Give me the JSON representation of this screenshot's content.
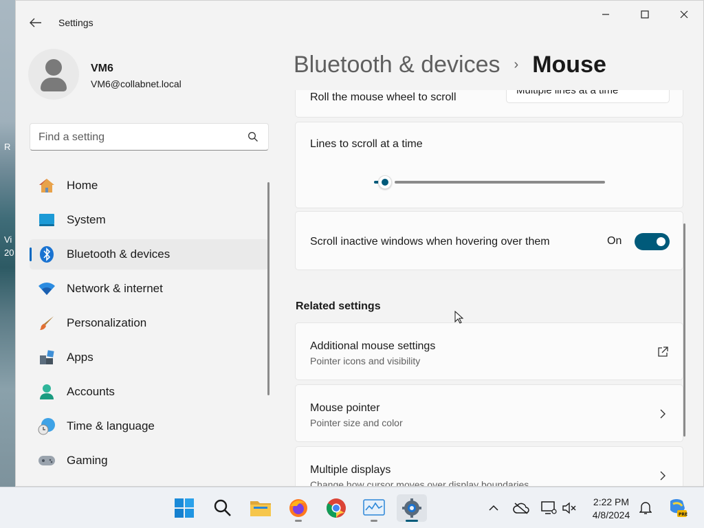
{
  "desktop": {
    "fragments": [
      "R",
      "Vi",
      "20"
    ]
  },
  "window": {
    "title": "Settings",
    "controls": [
      "minimize",
      "maximize",
      "close"
    ]
  },
  "profile": {
    "name": "VM6",
    "email": "VM6@collabnet.local"
  },
  "search": {
    "placeholder": "Find a setting"
  },
  "nav": {
    "items": [
      {
        "label": "Home",
        "icon": "home-icon"
      },
      {
        "label": "System",
        "icon": "system-icon"
      },
      {
        "label": "Bluetooth & devices",
        "icon": "bluetooth-icon",
        "active": true
      },
      {
        "label": "Network & internet",
        "icon": "wifi-icon"
      },
      {
        "label": "Personalization",
        "icon": "brush-icon"
      },
      {
        "label": "Apps",
        "icon": "apps-icon"
      },
      {
        "label": "Accounts",
        "icon": "accounts-icon"
      },
      {
        "label": "Time & language",
        "icon": "clock-globe-icon"
      },
      {
        "label": "Gaming",
        "icon": "gamepad-icon"
      }
    ]
  },
  "breadcrumb": {
    "parent": "Bluetooth & devices",
    "separator": "›",
    "current": "Mouse"
  },
  "settings": {
    "roll_wheel": {
      "label": "Roll the mouse wheel to scroll",
      "value": "Multiple lines at a time"
    },
    "lines_to_scroll": {
      "label": "Lines to scroll at a time",
      "value_fraction": 0.02
    },
    "scroll_inactive": {
      "label": "Scroll inactive windows when hovering over them",
      "state": "On"
    }
  },
  "related": {
    "title": "Related settings",
    "items": [
      {
        "title": "Additional mouse settings",
        "subtitle": "Pointer icons and visibility",
        "icon": "external-link-icon"
      },
      {
        "title": "Mouse pointer",
        "subtitle": "Pointer size and color",
        "icon": "chevron-right-icon"
      },
      {
        "title": "Multiple displays",
        "subtitle": "Change how cursor moves over display boundaries",
        "icon": "chevron-right-icon"
      }
    ]
  },
  "taskbar": {
    "apps": [
      "start",
      "search",
      "file-explorer",
      "firefox",
      "chrome",
      "task-manager",
      "settings"
    ],
    "clock": {
      "time": "2:22 PM",
      "date": "4/8/2024"
    }
  },
  "colors": {
    "accent": "#005a7a",
    "nav_indicator": "#0067c0"
  }
}
